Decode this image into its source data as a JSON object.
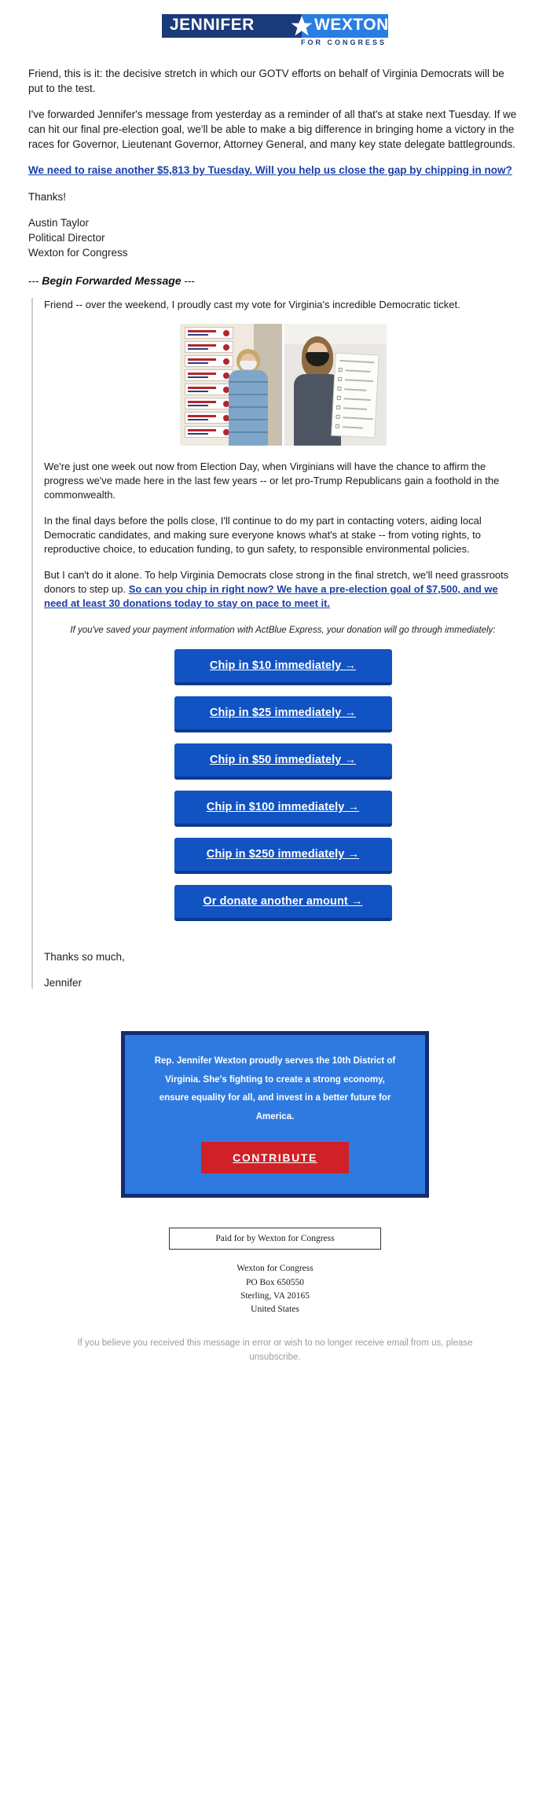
{
  "brand": {
    "logo_first_name": "JENNIFER",
    "logo_last_name": "WEXTON",
    "logo_tagline": "FOR CONGRESS",
    "navy": "#1b3a7a",
    "blue": "#2a7de1",
    "button_blue": "#1253c3",
    "button_blue_shadow": "#0b3b8f",
    "promo_blue": "#2f7ae0",
    "promo_border": "#132e6e",
    "contribute_red": "#cf2127",
    "link_blue": "#1a3faa"
  },
  "intro": {
    "p1": "Friend, this is it: the decisive stretch in which our GOTV efforts on behalf of Virginia Democrats will be put to the test.",
    "p2": "I've forwarded Jennifer's message from yesterday as a reminder of all that's at stake next Tuesday. If we can hit our final pre-election goal, we'll be able to make a big difference in bringing home a victory in the races for Governor, Lieutenant Governor, Attorney General, and many key state delegate battlegrounds.",
    "cta_link": "We need to raise another $5,813 by Tuesday. Will you help us close the gap by chipping in now?",
    "thanks": "Thanks!",
    "signature_name": "Austin Taylor",
    "signature_title": "Political Director",
    "signature_org": "Wexton for Congress"
  },
  "forwarded_header": {
    "prefix": "---",
    "label": "Begin Forwarded Message",
    "suffix": "---"
  },
  "forwarded": {
    "p1": "Friend -- over the weekend, I proudly cast my vote for Virginia's incredible Democratic ticket.",
    "p2": "We're just one week out now from Election Day, when Virginians will have the chance to affirm the progress we've made here in the last few years -- or let pro-Trump Republicans gain a foothold in the commonwealth.",
    "p3": "In the final days before the polls close, I'll continue to do my part in contacting voters, aiding local Democratic candidates, and making sure everyone knows what's at stake -- from voting rights, to reproductive choice, to education funding, to gun safety, to responsible environmental policies.",
    "p4_lead": "But I can't do it alone. To help Virginia Democrats close strong in the final stretch, we'll need grassroots donors to step up. ",
    "p4_link": "So can you chip in right now? We have a pre-election goal of $7,500, and we need at least 30 donations today to stay on pace to meet it.",
    "express_note": "If you've saved your payment information with ActBlue Express, your donation will go through immediately:",
    "thanks": "Thanks so much,",
    "signoff": "Jennifer"
  },
  "photos": [
    {
      "alt": "woman standing in front of Loudoun County election signs"
    },
    {
      "alt": "woman in black face mask holding a ballot"
    }
  ],
  "donate_buttons": [
    {
      "label": "Chip in $10 immediately  →",
      "amount": "$10"
    },
    {
      "label": "Chip in $25 immediately  →",
      "amount": "$25"
    },
    {
      "label": "Chip in $50 immediately  →",
      "amount": "$50"
    },
    {
      "label": "Chip in $100 immediately  →",
      "amount": "$100"
    },
    {
      "label": "Chip in $250 immediately  →",
      "amount": "$250"
    },
    {
      "label": "Or donate another amount  →",
      "amount": "other"
    }
  ],
  "promo": {
    "text": "Rep. Jennifer Wexton proudly serves the 10th District of Virginia. She's fighting to create a strong economy, ensure equality for all, and invest in a better future for America.",
    "button_label": "CONTRIBUTE"
  },
  "footer": {
    "paid_for": "Paid for by Wexton for Congress",
    "address_lines": [
      "Wexton for Congress",
      "PO Box 650550",
      "Sterling, VA 20165",
      "United States"
    ],
    "unsubscribe": "If you believe you received this message in error or wish to no longer receive email from us, please unsubscribe."
  }
}
